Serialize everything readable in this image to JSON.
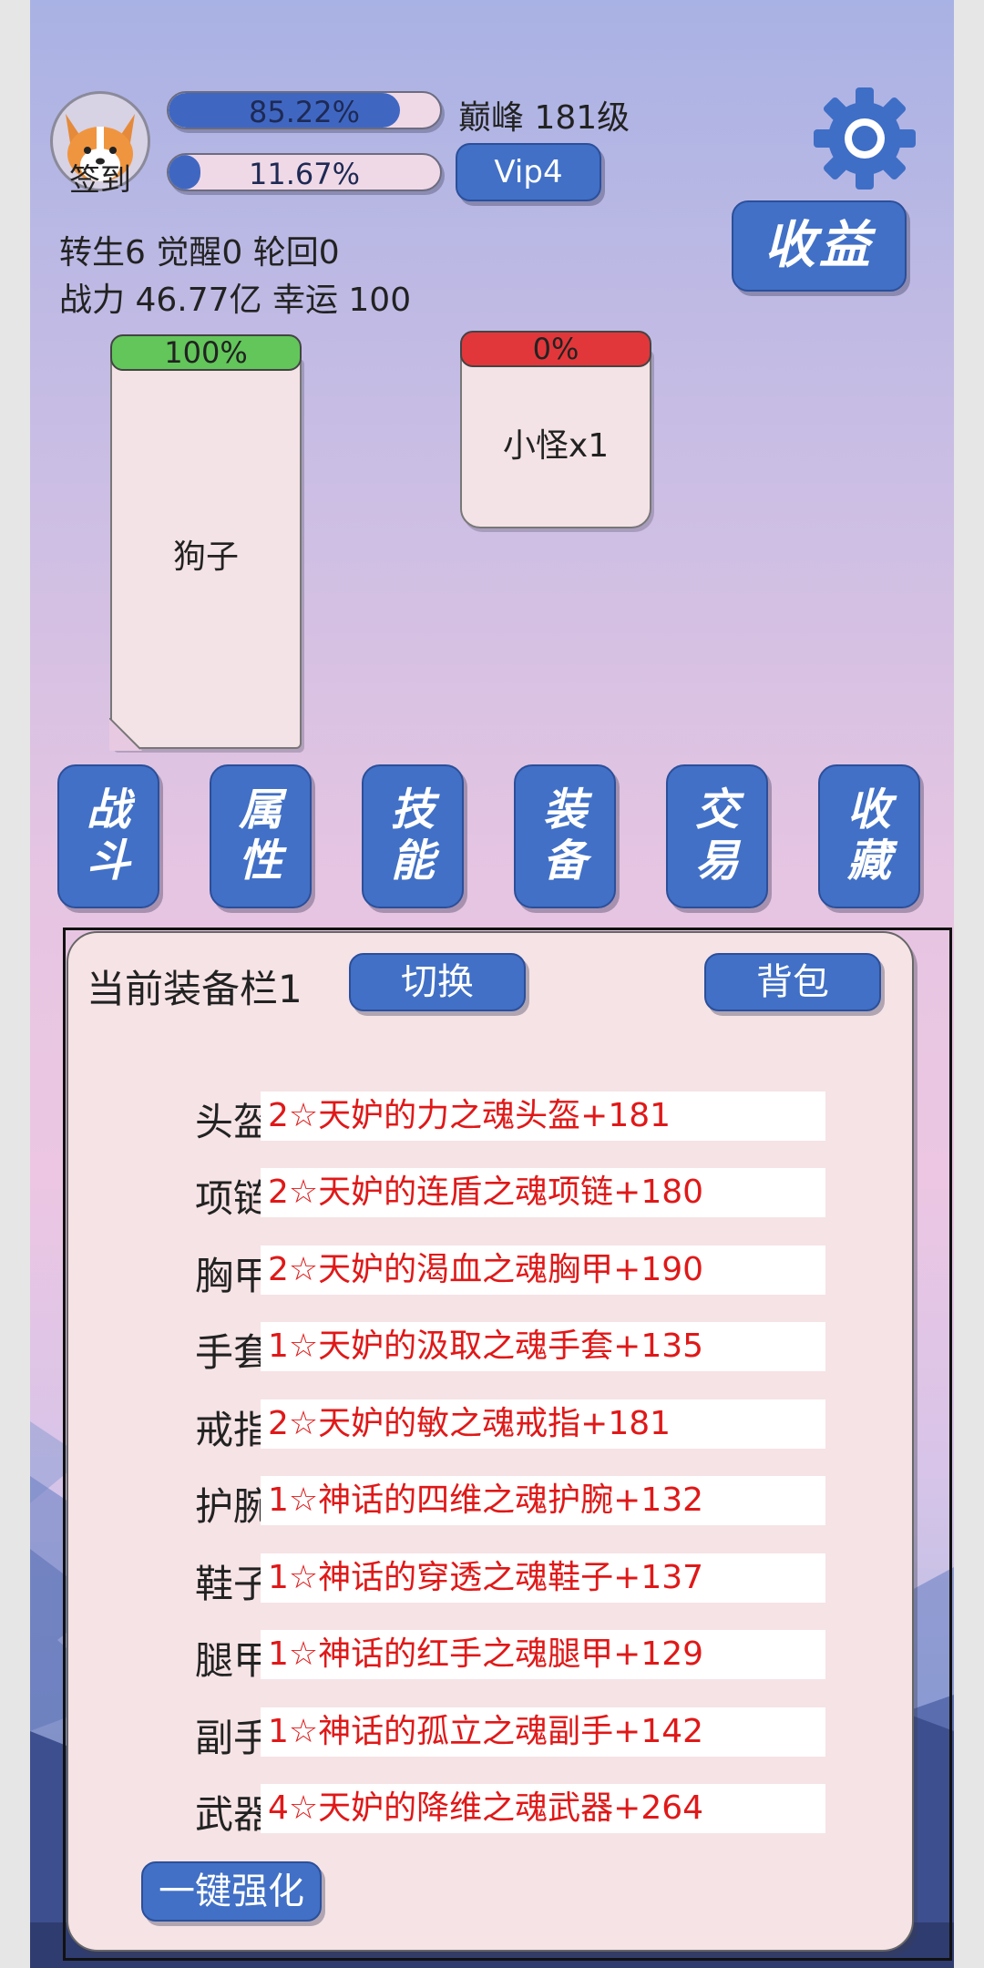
{
  "player": {
    "checkin_label": "签到",
    "exp_percent": "85.22%",
    "exp_fill": 0.8522,
    "second_percent": "11.67%",
    "second_fill": 0.1167,
    "rank": "巅峰 181级",
    "vip": "Vip4",
    "stats_line1": "转生6 觉醒0 轮回0",
    "stats_line2": "战力 46.77亿  幸运 100"
  },
  "header": {
    "earnings_label": "收益"
  },
  "battle": {
    "player_hp": "100%",
    "player_name": "狗子",
    "enemy_hp": "0%",
    "enemy_name": "小怪x1"
  },
  "nav": [
    {
      "line1": "战",
      "line2": "斗"
    },
    {
      "line1": "属",
      "line2": "性"
    },
    {
      "line1": "技",
      "line2": "能"
    },
    {
      "line1": "装",
      "line2": "备"
    },
    {
      "line1": "交",
      "line2": "易"
    },
    {
      "line1": "收",
      "line2": "藏"
    }
  ],
  "equipment": {
    "title": "当前装备栏1",
    "switch_label": "切换",
    "bag_label": "背包",
    "enhance_label": "一键强化",
    "slots": [
      {
        "label": "头盔",
        "item": "2☆天妒的力之魂头盔+181"
      },
      {
        "label": "项链",
        "item": "2☆天妒的连盾之魂项链+180"
      },
      {
        "label": "胸甲",
        "item": "2☆天妒的渴血之魂胸甲+190"
      },
      {
        "label": "手套",
        "item": "1☆天妒的汲取之魂手套+135"
      },
      {
        "label": "戒指",
        "item": "2☆天妒的敏之魂戒指+181"
      },
      {
        "label": "护腕",
        "item": "1☆神话的四维之魂护腕+132"
      },
      {
        "label": "鞋子",
        "item": "1☆神话的穿透之魂鞋子+137"
      },
      {
        "label": "腿甲",
        "item": "1☆神话的红手之魂腿甲+129"
      },
      {
        "label": "副手",
        "item": "1☆神话的孤立之魂副手+142"
      },
      {
        "label": "武器",
        "item": "4☆天妒的降维之魂武器+264"
      }
    ]
  },
  "colors": {
    "button_blue": "#4170c6",
    "hp_green": "#62c65a",
    "hp_red": "#e2373a",
    "item_red": "#e01818"
  }
}
